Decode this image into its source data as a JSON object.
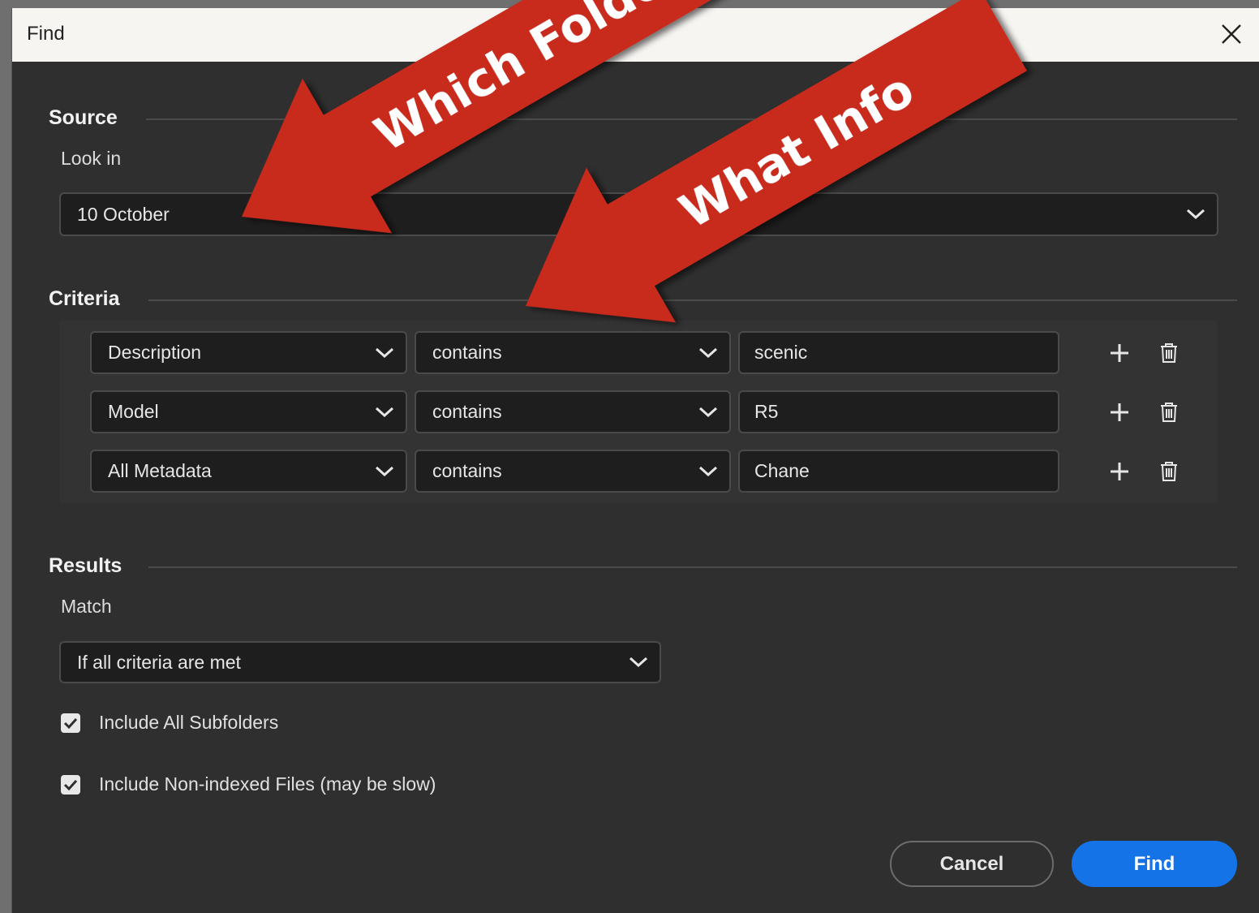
{
  "window": {
    "title": "Find"
  },
  "source": {
    "heading": "Source",
    "look_in_label": "Look in",
    "look_in_value": "10 October"
  },
  "criteria": {
    "heading": "Criteria",
    "rows": [
      {
        "field": "Description",
        "operator": "contains",
        "value": "scenic"
      },
      {
        "field": "Model",
        "operator": "contains",
        "value": "R5"
      },
      {
        "field": "All Metadata",
        "operator": "contains",
        "value": "Chane"
      }
    ]
  },
  "results": {
    "heading": "Results",
    "match_label": "Match",
    "match_value": "If all criteria are met",
    "include_subfolders": {
      "label": "Include All Subfolders",
      "checked": true
    },
    "include_nonindexed": {
      "label": "Include Non-indexed Files (may be slow)",
      "checked": true
    }
  },
  "buttons": {
    "cancel": "Cancel",
    "find": "Find"
  },
  "annotations": {
    "arrow1": "Which Folder",
    "arrow2": "What Info",
    "arrow_color": "#c8291e"
  },
  "colors": {
    "accent": "#1473e6",
    "dialog_bg": "#2f2f2f",
    "titlebar_bg": "#f7f5f2"
  }
}
